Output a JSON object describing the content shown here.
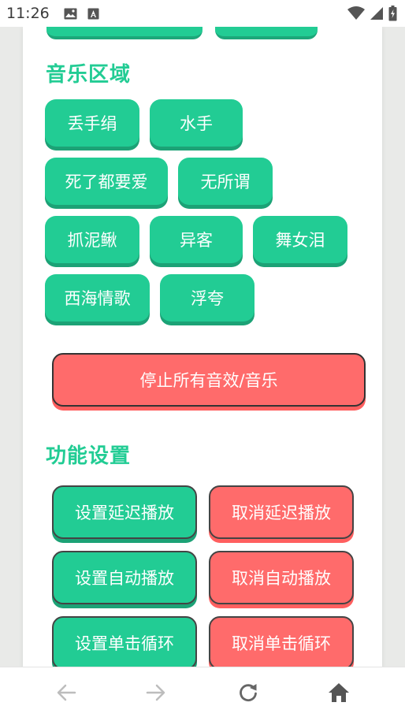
{
  "status_bar": {
    "time": "11:26"
  },
  "music_section": {
    "title": "音乐区域",
    "buttons": [
      "丢手绢",
      "水手",
      "死了都要爱",
      "无所谓",
      "抓泥鳅",
      "异客",
      "舞女泪",
      "西海情歌",
      "浮夸"
    ]
  },
  "stop_button": {
    "label": "停止所有音效/音乐"
  },
  "function_section": {
    "title": "功能设置",
    "set_delay": "设置延迟播放",
    "cancel_delay": "取消延迟播放",
    "set_auto": "设置自动播放",
    "cancel_auto": "取消自动播放",
    "set_loop": "设置单击循环",
    "cancel_loop": "取消单击循环"
  },
  "colors": {
    "green": "#22cc94",
    "red": "#ff6b6b"
  }
}
